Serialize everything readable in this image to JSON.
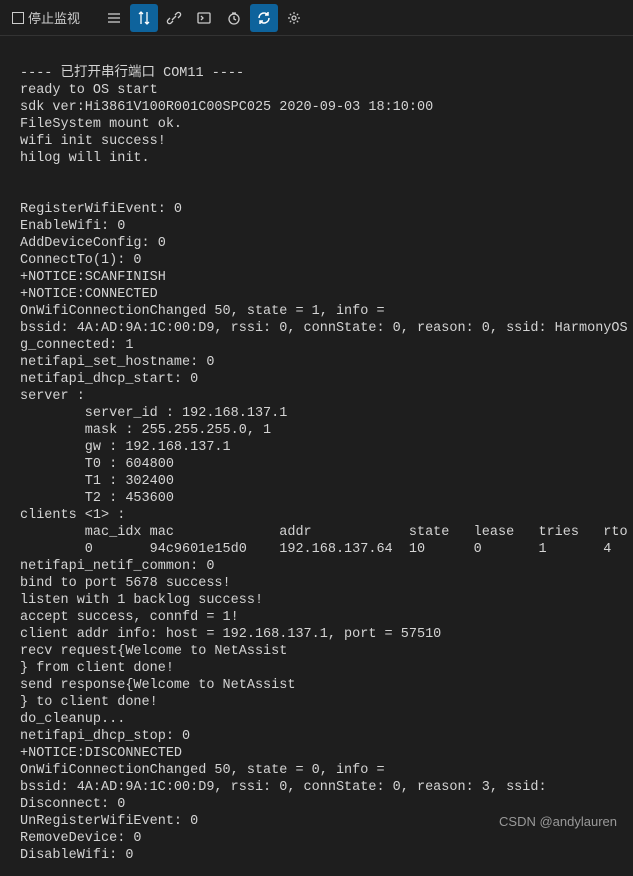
{
  "toolbar": {
    "stop_label": "停止监视"
  },
  "terminal": {
    "lines": [
      "",
      "---- 已打开串行端口 COM11 ----",
      "ready to OS start",
      "sdk ver:Hi3861V100R001C00SPC025 2020-09-03 18:10:00",
      "FileSystem mount ok.",
      "wifi init success!",
      "hilog will init.",
      "",
      "",
      "RegisterWifiEvent: 0",
      "EnableWifi: 0",
      "AddDeviceConfig: 0",
      "ConnectTo(1): 0",
      "+NOTICE:SCANFINISH",
      "+NOTICE:CONNECTED",
      "OnWifiConnectionChanged 50, state = 1, info =",
      "bssid: 4A:AD:9A:1C:00:D9, rssi: 0, connState: 0, reason: 0, ssid: HarmonyOS",
      "g_connected: 1",
      "netifapi_set_hostname: 0",
      "netifapi_dhcp_start: 0",
      "server :",
      "        server_id : 192.168.137.1",
      "        mask : 255.255.255.0, 1",
      "        gw : 192.168.137.1",
      "        T0 : 604800",
      "        T1 : 302400",
      "        T2 : 453600",
      "clients <1> :",
      "        mac_idx mac             addr            state   lease   tries   rto",
      "        0       94c9601e15d0    192.168.137.64  10      0       1       4",
      "netifapi_netif_common: 0",
      "bind to port 5678 success!",
      "listen with 1 backlog success!",
      "accept success, connfd = 1!",
      "client addr info: host = 192.168.137.1, port = 57510",
      "recv request{Welcome to NetAssist",
      "} from client done!",
      "send response{Welcome to NetAssist",
      "} to client done!",
      "do_cleanup...",
      "netifapi_dhcp_stop: 0",
      "+NOTICE:DISCONNECTED",
      "OnWifiConnectionChanged 50, state = 0, info =",
      "bssid: 4A:AD:9A:1C:00:D9, rssi: 0, connState: 0, reason: 3, ssid:",
      "Disconnect: 0",
      "UnRegisterWifiEvent: 0",
      "RemoveDevice: 0",
      "DisableWifi: 0"
    ]
  },
  "watermark": "CSDN @andylauren"
}
